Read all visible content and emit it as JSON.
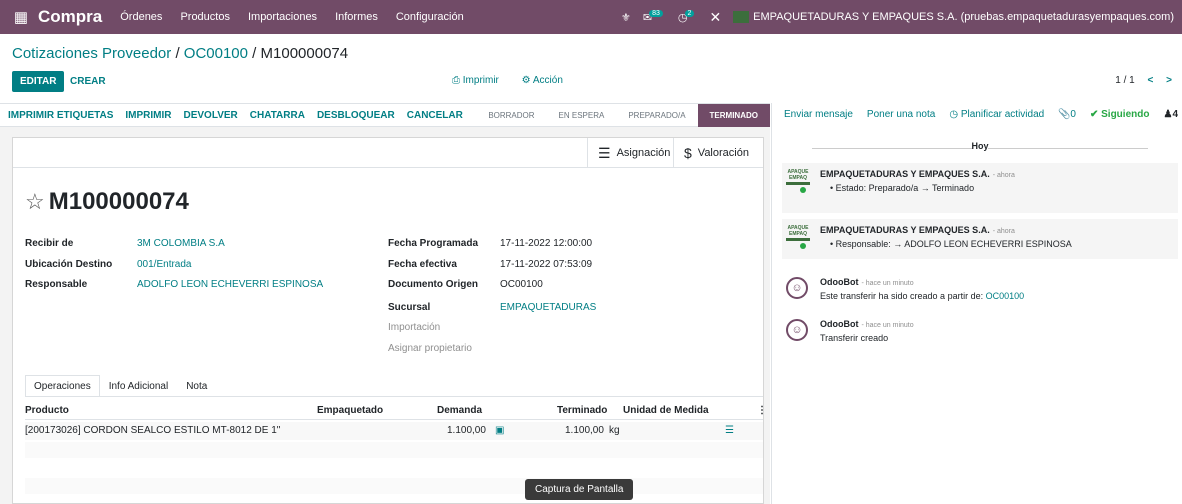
{
  "navbar": {
    "app_name": "Compra",
    "menu": [
      "Órdenes",
      "Productos",
      "Importaciones",
      "Informes",
      "Configuración"
    ],
    "messages_count": "83",
    "activities_count": "2",
    "company": "EMPAQUETADURAS Y EMPAQUES S.A. (pruebas.empaquetadurasyempaques.com)"
  },
  "breadcrumb": {
    "part1": "Cotizaciones Proveedor",
    "part2": "OC00100",
    "current": "M100000074"
  },
  "control": {
    "edit": "EDITAR",
    "create": "CREAR",
    "print": "Imprimir",
    "action": "Acción",
    "pager": "1 / 1"
  },
  "statusbar": {
    "buttons": [
      "IMPRIMIR ETIQUETAS",
      "IMPRIMIR",
      "DEVOLVER",
      "CHATARRA",
      "DESBLOQUEAR",
      "CANCELAR"
    ],
    "steps": [
      "BORRADOR",
      "EN ESPERA",
      "PREPARADO/A",
      "TERMINADO"
    ]
  },
  "smart_buttons": {
    "assignment": "Asignación",
    "valuation": "Valoración"
  },
  "record": {
    "name": "M100000074",
    "left": [
      {
        "label": "Recibir de",
        "value": "3M COLOMBIA S.A"
      },
      {
        "label": "Ubicación Destino",
        "value": "001/Entrada"
      },
      {
        "label": "Responsable",
        "value": "ADOLFO LEON ECHEVERRI ESPINOSA"
      }
    ],
    "right": [
      {
        "label": "Fecha Programada",
        "value": "17-11-2022 12:00:00"
      },
      {
        "label": "Fecha efectiva",
        "value": "17-11-2022 07:53:09"
      },
      {
        "label": "Documento Origen",
        "value": "OC00100"
      },
      {
        "label": "Sucursal",
        "value": "EMPAQUETADURAS"
      },
      {
        "label": "Importación",
        "value": ""
      },
      {
        "label": "Asignar propietario",
        "value": ""
      }
    ]
  },
  "tabs": [
    "Operaciones",
    "Info Adicional",
    "Nota"
  ],
  "table": {
    "headers": [
      "Producto",
      "Empaquetado",
      "Demanda",
      "Terminado",
      "Unidad de Medida"
    ],
    "rows": [
      {
        "product": "[200173026] CORDON SEALCO ESTILO MT-8012 DE 1\"",
        "packaging": "",
        "demand": "1.100,00",
        "done": "1.100,00",
        "uom": "kg"
      }
    ]
  },
  "tooltip": "Captura de Pantalla",
  "chatter": {
    "send_message": "Enviar mensaje",
    "log_note": "Poner una nota",
    "schedule": "Planificar actividad",
    "attachments": "0",
    "following": "Siguiendo",
    "followers": "4",
    "day": "Hoy",
    "messages": [
      {
        "author": "EMPAQUETADURAS Y EMPAQUES S.A.",
        "time": "- ahora",
        "body": "Estado: Preparado/a → Terminado"
      },
      {
        "author": "EMPAQUETADURAS Y EMPAQUES S.A.",
        "time": "- ahora",
        "body": "Responsable: → ADOLFO LEON ECHEVERRI ESPINOSA"
      },
      {
        "author": "OdooBot",
        "time": "- hace un minuto",
        "body": "Este transferir ha sido creado a partir de: ",
        "link": "OC00100"
      },
      {
        "author": "OdooBot",
        "time": "- hace un minuto",
        "body": "Transferir creado"
      }
    ]
  },
  "colors": {
    "brand": "#714b67",
    "link": "#017e84",
    "success": "#28a745"
  }
}
